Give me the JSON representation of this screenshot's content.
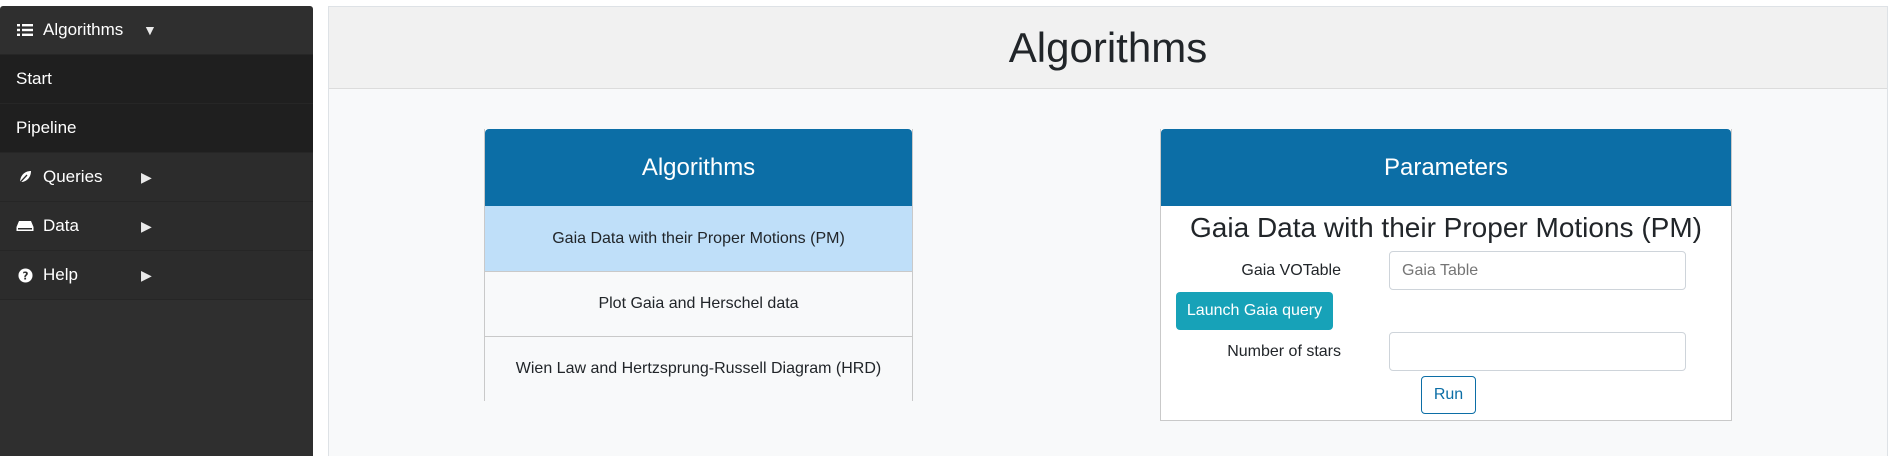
{
  "sidebar": {
    "items": [
      {
        "label": "Algorithms",
        "icon": "list-icon",
        "arrow": "▼"
      },
      {
        "label": "Start"
      },
      {
        "label": "Pipeline"
      },
      {
        "label": "Queries",
        "icon": "leaf-icon",
        "arrow": "▶"
      },
      {
        "label": "Data",
        "icon": "hdd-icon",
        "arrow": "▶"
      },
      {
        "label": "Help",
        "icon": "question-circle-icon",
        "arrow": "▶"
      }
    ]
  },
  "main": {
    "title": "Algorithms"
  },
  "algorithms_card": {
    "header": "Algorithms",
    "items": [
      {
        "label": "Gaia Data with their Proper Motions (PM)",
        "selected": true
      },
      {
        "label": "Plot Gaia and Herschel data",
        "selected": false
      },
      {
        "label": "Wien Law and Hertzsprung-Russell Diagram (HRD)",
        "selected": false
      }
    ]
  },
  "parameters_card": {
    "header": "Parameters",
    "title": "Gaia Data with their Proper Motions (PM)",
    "gaia_votable_label": "Gaia VOTable",
    "gaia_votable_placeholder": "Gaia Table",
    "gaia_votable_value": "",
    "launch_button": "Launch Gaia query",
    "num_stars_label": "Number of stars",
    "num_stars_value": "",
    "run_button": "Run"
  },
  "colors": {
    "sidebar_bg": "#2f2f2f",
    "card_header": "#0c6ea6",
    "selected_item": "#bfdff9",
    "launch_button": "#17a2b8"
  }
}
